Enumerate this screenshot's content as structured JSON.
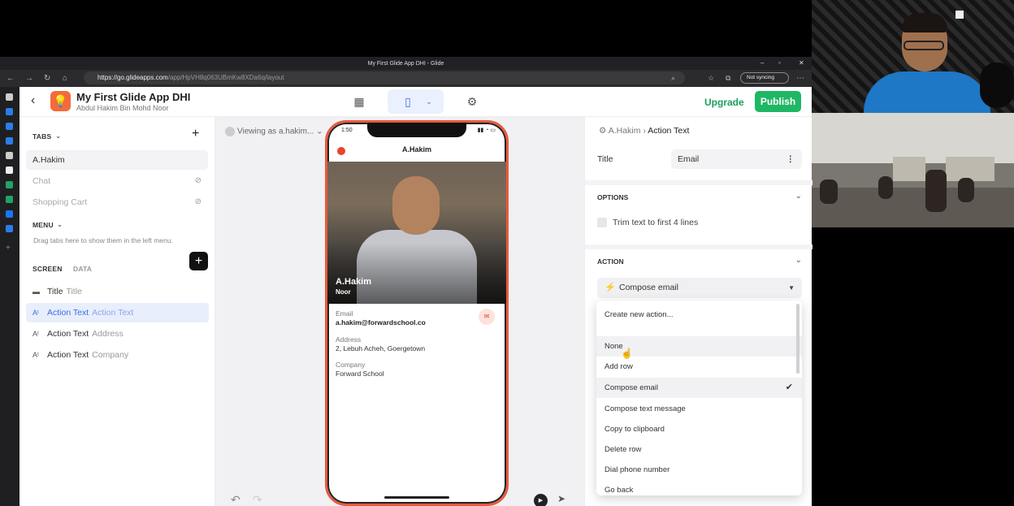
{
  "browser": {
    "window_title": "My First Glide App DHI - Glide",
    "url_prefix": "https://go.glideapps.com",
    "url_path": "/app/HpVH8q063UBmKw8XDa6q/layout",
    "sync_label": "Not syncing"
  },
  "app": {
    "name": "My First Glide App DHI",
    "owner": "Abdul Hakim Bin Mohd Noor",
    "upgrade_label": "Upgrade",
    "publish_label": "Publish"
  },
  "left": {
    "tabs_header": "TABS",
    "tabs": [
      {
        "label": "A.Hakim"
      },
      {
        "label": "Chat"
      },
      {
        "label": "Shopping Cart"
      }
    ],
    "menu_header": "MENU",
    "menu_hint": "Drag tabs here to show them in the left menu.",
    "screen_tab": "SCREEN",
    "data_tab": "DATA",
    "components": [
      {
        "type": "Title",
        "value": "Title"
      },
      {
        "type": "Action Text",
        "value": "Action Text"
      },
      {
        "type": "Action Text",
        "value": "Address"
      },
      {
        "type": "Action Text",
        "value": "Company"
      }
    ]
  },
  "canvas": {
    "viewing_as": "Viewing as a.hakim..."
  },
  "phone": {
    "time": "1:50",
    "header": "A.Hakim",
    "name_line1": "A.Hakim",
    "name_line2": "Noor",
    "fields": [
      {
        "label": "Email",
        "value": "a.hakim@forwardschool.co"
      },
      {
        "label": "Address",
        "value": "2, Lebuh Acheh, Goergetown"
      },
      {
        "label": "Company",
        "value": "Forward School"
      }
    ]
  },
  "right": {
    "crumb_parent": "A.Hakim",
    "crumb_current": "Action Text",
    "title_label": "Title",
    "title_value": "Email",
    "options_header": "OPTIONS",
    "trim_label": "Trim text to first 4 lines",
    "action_header": "ACTION",
    "action_selected": "Compose email",
    "action_options": [
      "Create new action...",
      "None",
      "Add row",
      "Compose email",
      "Compose text message",
      "Copy to clipboard",
      "Delete row",
      "Dial phone number",
      "Go back"
    ]
  }
}
